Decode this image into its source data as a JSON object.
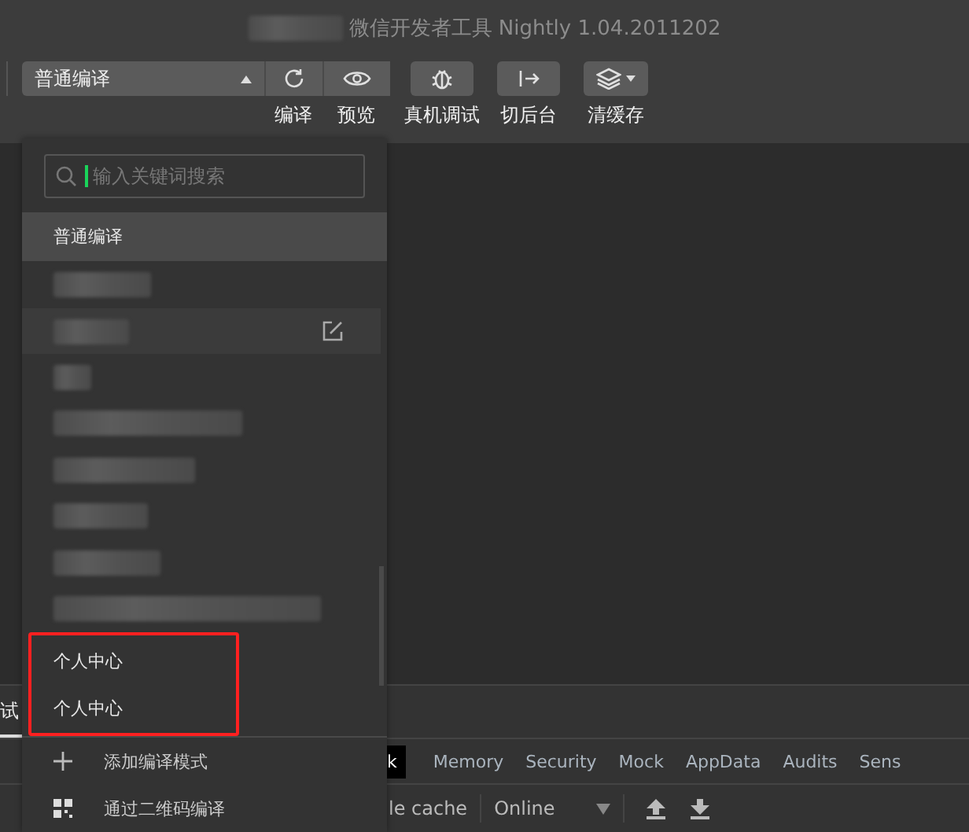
{
  "window": {
    "title": "微信开发者工具 Nightly 1.04.2011202",
    "title_redacted": true
  },
  "toolbar": {
    "compile_mode": {
      "value": "普通编译",
      "expanded": true
    },
    "tools": [
      {
        "label": "编译"
      },
      {
        "label": "预览"
      },
      {
        "label": "真机调试"
      },
      {
        "label": "切后台"
      },
      {
        "label": "清缓存"
      }
    ]
  },
  "compile_menu": {
    "search": {
      "placeholder": "输入关键词搜索",
      "focused": true
    },
    "items": [
      {
        "kind": "text",
        "label": "普通编译",
        "selected": true,
        "hovered": false,
        "highlighted": false
      },
      {
        "kind": "redacted",
        "selected": false,
        "hovered": false
      },
      {
        "kind": "redacted",
        "selected": false,
        "hovered": true
      },
      {
        "kind": "redacted",
        "selected": false,
        "hovered": false
      },
      {
        "kind": "redacted",
        "selected": false,
        "hovered": false
      },
      {
        "kind": "redacted",
        "selected": false,
        "hovered": false
      },
      {
        "kind": "redacted",
        "selected": false,
        "hovered": false
      },
      {
        "kind": "redacted",
        "selected": false,
        "hovered": false
      },
      {
        "kind": "redacted",
        "selected": false,
        "hovered": false
      },
      {
        "kind": "text",
        "label": "个人中心",
        "selected": false,
        "hovered": false,
        "highlighted": true
      },
      {
        "kind": "text",
        "label": "个人中心",
        "selected": false,
        "hovered": false,
        "highlighted": true
      }
    ],
    "actions": [
      {
        "label": "添加编译模式"
      },
      {
        "label": "通过二维码编译"
      }
    ]
  },
  "devtools": {
    "panel_tabs": [
      {
        "label": "试",
        "selected": true
      }
    ],
    "tabs": [
      {
        "label": "k",
        "selected": true
      },
      {
        "label": "Memory",
        "selected": false
      },
      {
        "label": "Security",
        "selected": false
      },
      {
        "label": "Mock",
        "selected": false
      },
      {
        "label": "AppData",
        "selected": false
      },
      {
        "label": "Audits",
        "selected": false
      },
      {
        "label": "Sens",
        "selected": false
      }
    ],
    "toolbar": {
      "cache_label": "le cache",
      "throttle": "Online"
    }
  }
}
